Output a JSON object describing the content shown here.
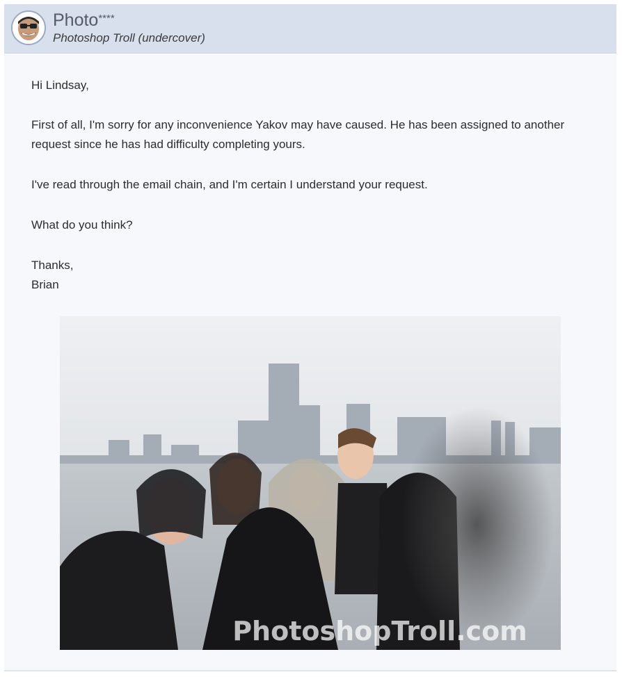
{
  "sender": {
    "name": "Photo",
    "name_suffix": "****",
    "subtitle": "Photoshop Troll (undercover)"
  },
  "message": {
    "greeting": "Hi Lindsay,",
    "paragraph1_line1": "First of all, I'm sorry for any inconvenience Yakov may have caused. He has been assigned to another",
    "paragraph1_line2": "request since he has had difficulty completing yours.",
    "paragraph2": "I've read through the email chain, and I'm certain I understand your request.",
    "paragraph3": "What do you think?",
    "signoff": "Thanks,",
    "signature": "Brian"
  },
  "photo": {
    "watermark": "PhotoshopTroll.com"
  },
  "colors": {
    "header_bg": "#d8e0ee",
    "body_bg": "#f7f8fc"
  }
}
